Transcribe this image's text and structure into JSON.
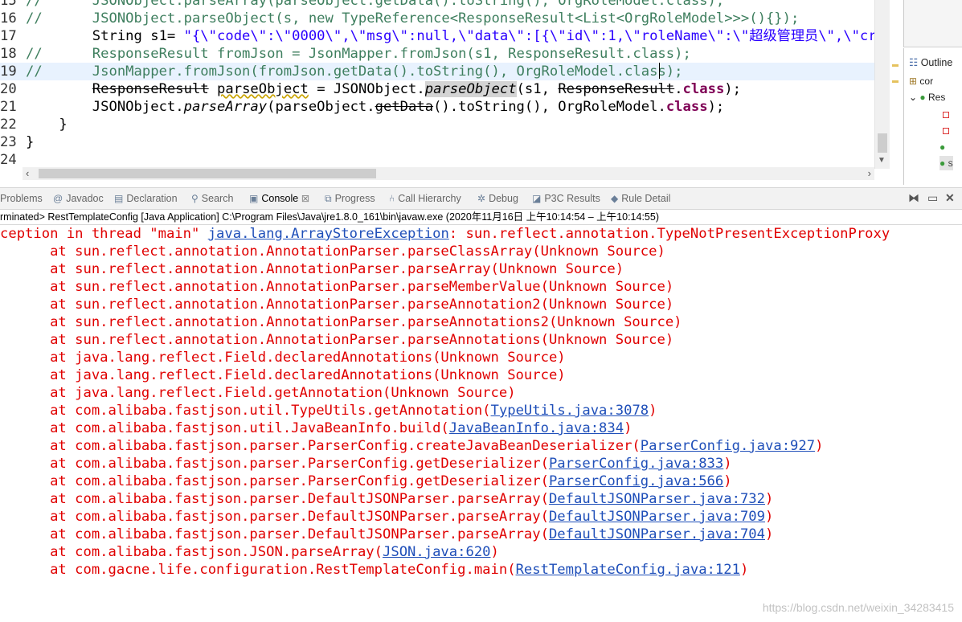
{
  "editor": {
    "lines": [
      {
        "n": "15",
        "parts": [
          {
            "t": "//      JSONObject.parseArray(parseObject.getData().toString(), OrgRoleModel.class);",
            "c": "cm"
          }
        ]
      },
      {
        "n": "16",
        "parts": [
          {
            "t": "//      JSONObject.parseObject(s, new TypeReference<ResponseResult<List<OrgRoleModel>>>(){});",
            "c": "cm"
          }
        ]
      },
      {
        "n": "17",
        "parts": [
          {
            "t": "        String s1= ",
            "c": ""
          },
          {
            "t": "\"{\\\"code\\\":\\\"0000\\\",\\\"msg\\\":null,\\\"data\\\":[{\\\"id\\\":1,\\\"roleName\\\":\\\"超级管理员\\\",\\\"create",
            "c": "str"
          }
        ]
      },
      {
        "n": "18",
        "parts": [
          {
            "t": "//      ResponseResult fromJson = JsonMapper.fromJson(s1, ResponseResult.class);",
            "c": "cm"
          }
        ]
      },
      {
        "n": "19",
        "parts": [
          {
            "t": "//      JsonMapper.fromJson(fromJson.getData().toString(), OrgRoleModel.class);",
            "c": "cm"
          }
        ]
      },
      {
        "n": "20",
        "parts": [
          {
            "t": "        ",
            "c": ""
          },
          {
            "t": "ResponseResult",
            "c": "del"
          },
          {
            "t": " ",
            "c": ""
          },
          {
            "t": "parseObject",
            "c": "warnul"
          },
          {
            "t": " = JSONObject.",
            "c": ""
          },
          {
            "t": "parseObject",
            "c": "it hl"
          },
          {
            "t": "(s1, ",
            "c": ""
          },
          {
            "t": "ResponseResult",
            "c": "del"
          },
          {
            "t": ".",
            "c": ""
          },
          {
            "t": "class",
            "c": "kw"
          },
          {
            "t": ");",
            "c": ""
          }
        ]
      },
      {
        "n": "21",
        "parts": [
          {
            "t": "        JSONObject.",
            "c": ""
          },
          {
            "t": "parseArray",
            "c": "it"
          },
          {
            "t": "(parseObject.",
            "c": ""
          },
          {
            "t": "getData",
            "c": "del"
          },
          {
            "t": "().toString(), OrgRoleModel.",
            "c": ""
          },
          {
            "t": "class",
            "c": "kw"
          },
          {
            "t": ");",
            "c": ""
          }
        ]
      },
      {
        "n": "22",
        "parts": [
          {
            "t": "    }",
            "c": ""
          }
        ]
      },
      {
        "n": "23",
        "parts": [
          {
            "t": "}",
            "c": ""
          }
        ]
      },
      {
        "n": "24",
        "parts": []
      }
    ]
  },
  "outline": {
    "title": "Outline",
    "items": [
      "cor",
      "Res",
      "",
      "",
      "",
      "S"
    ]
  },
  "tabs": [
    {
      "label": "Problems",
      "icon": "problems-icon",
      "glyph": "⚠"
    },
    {
      "label": "Javadoc",
      "icon": "javadoc-icon",
      "glyph": "@"
    },
    {
      "label": "Declaration",
      "icon": "declaration-icon",
      "glyph": "▤"
    },
    {
      "label": "Search",
      "icon": "search-icon",
      "glyph": "⚲"
    },
    {
      "label": "Console",
      "icon": "console-icon",
      "glyph": "▣"
    },
    {
      "label": "Progress",
      "icon": "progress-icon",
      "glyph": "⧉"
    },
    {
      "label": "Call Hierarchy",
      "icon": "call-hierarchy-icon",
      "glyph": "⑃"
    },
    {
      "label": "Debug",
      "icon": "debug-icon",
      "glyph": "✲"
    },
    {
      "label": "P3C Results",
      "icon": "p3c-results-icon",
      "glyph": "◪"
    },
    {
      "label": "Rule Detail",
      "icon": "rule-detail-icon",
      "glyph": "◆"
    }
  ],
  "console": {
    "status": "rminated> RestTemplateConfig [Java Application] C:\\Program Files\\Java\\jre1.8.0_161\\bin\\javaw.exe  (2020年11月16日 上午10:14:54 – 上午10:14:55)",
    "lines": [
      [
        {
          "t": "ception in thread \"main\" "
        },
        {
          "t": "java.lang.ArrayStoreException",
          "link": true
        },
        {
          "t": ": sun.reflect.annotation.TypeNotPresentExceptionProxy"
        }
      ],
      [
        {
          "t": "      at sun.reflect.annotation.AnnotationParser.parseClassArray(Unknown Source)"
        }
      ],
      [
        {
          "t": "      at sun.reflect.annotation.AnnotationParser.parseArray(Unknown Source)"
        }
      ],
      [
        {
          "t": "      at sun.reflect.annotation.AnnotationParser.parseMemberValue(Unknown Source)"
        }
      ],
      [
        {
          "t": "      at sun.reflect.annotation.AnnotationParser.parseAnnotation2(Unknown Source)"
        }
      ],
      [
        {
          "t": "      at sun.reflect.annotation.AnnotationParser.parseAnnotations2(Unknown Source)"
        }
      ],
      [
        {
          "t": "      at sun.reflect.annotation.AnnotationParser.parseAnnotations(Unknown Source)"
        }
      ],
      [
        {
          "t": "      at java.lang.reflect.Field.declaredAnnotations(Unknown Source)"
        }
      ],
      [
        {
          "t": "      at java.lang.reflect.Field.declaredAnnotations(Unknown Source)"
        }
      ],
      [
        {
          "t": "      at java.lang.reflect.Field.getAnnotation(Unknown Source)"
        }
      ],
      [
        {
          "t": "      at com.alibaba.fastjson.util.TypeUtils.getAnnotation("
        },
        {
          "t": "TypeUtils.java:3078",
          "link": true
        },
        {
          "t": ")"
        }
      ],
      [
        {
          "t": "      at com.alibaba.fastjson.util.JavaBeanInfo.build("
        },
        {
          "t": "JavaBeanInfo.java:834",
          "link": true
        },
        {
          "t": ")"
        }
      ],
      [
        {
          "t": "      at com.alibaba.fastjson.parser.ParserConfig.createJavaBeanDeserializer("
        },
        {
          "t": "ParserConfig.java:927",
          "link": true
        },
        {
          "t": ")"
        }
      ],
      [
        {
          "t": "      at com.alibaba.fastjson.parser.ParserConfig.getDeserializer("
        },
        {
          "t": "ParserConfig.java:833",
          "link": true
        },
        {
          "t": ")"
        }
      ],
      [
        {
          "t": "      at com.alibaba.fastjson.parser.ParserConfig.getDeserializer("
        },
        {
          "t": "ParserConfig.java:566",
          "link": true
        },
        {
          "t": ")"
        }
      ],
      [
        {
          "t": "      at com.alibaba.fastjson.parser.DefaultJSONParser.parseArray("
        },
        {
          "t": "DefaultJSONParser.java:732",
          "link": true
        },
        {
          "t": ")"
        }
      ],
      [
        {
          "t": "      at com.alibaba.fastjson.parser.DefaultJSONParser.parseArray("
        },
        {
          "t": "DefaultJSONParser.java:709",
          "link": true
        },
        {
          "t": ")"
        }
      ],
      [
        {
          "t": "      at com.alibaba.fastjson.parser.DefaultJSONParser.parseArray("
        },
        {
          "t": "DefaultJSONParser.java:704",
          "link": true
        },
        {
          "t": ")"
        }
      ],
      [
        {
          "t": "      at com.alibaba.fastjson.JSON.parseArray("
        },
        {
          "t": "JSON.java:620",
          "link": true
        },
        {
          "t": ")"
        }
      ],
      [
        {
          "t": "      at com.gacne.life.configuration.RestTemplateConfig.main("
        },
        {
          "t": "RestTemplateConfig.java:121",
          "link": true
        },
        {
          "t": ")"
        }
      ]
    ]
  },
  "watermark": "https://blog.csdn.net/weixin_34283415",
  "colors": {
    "error_red": "#e00000",
    "link_blue": "#1f4fb9",
    "comment_green": "#3f7f5f",
    "keyword_purple": "#7f0055",
    "string_blue": "#2a00ff"
  }
}
